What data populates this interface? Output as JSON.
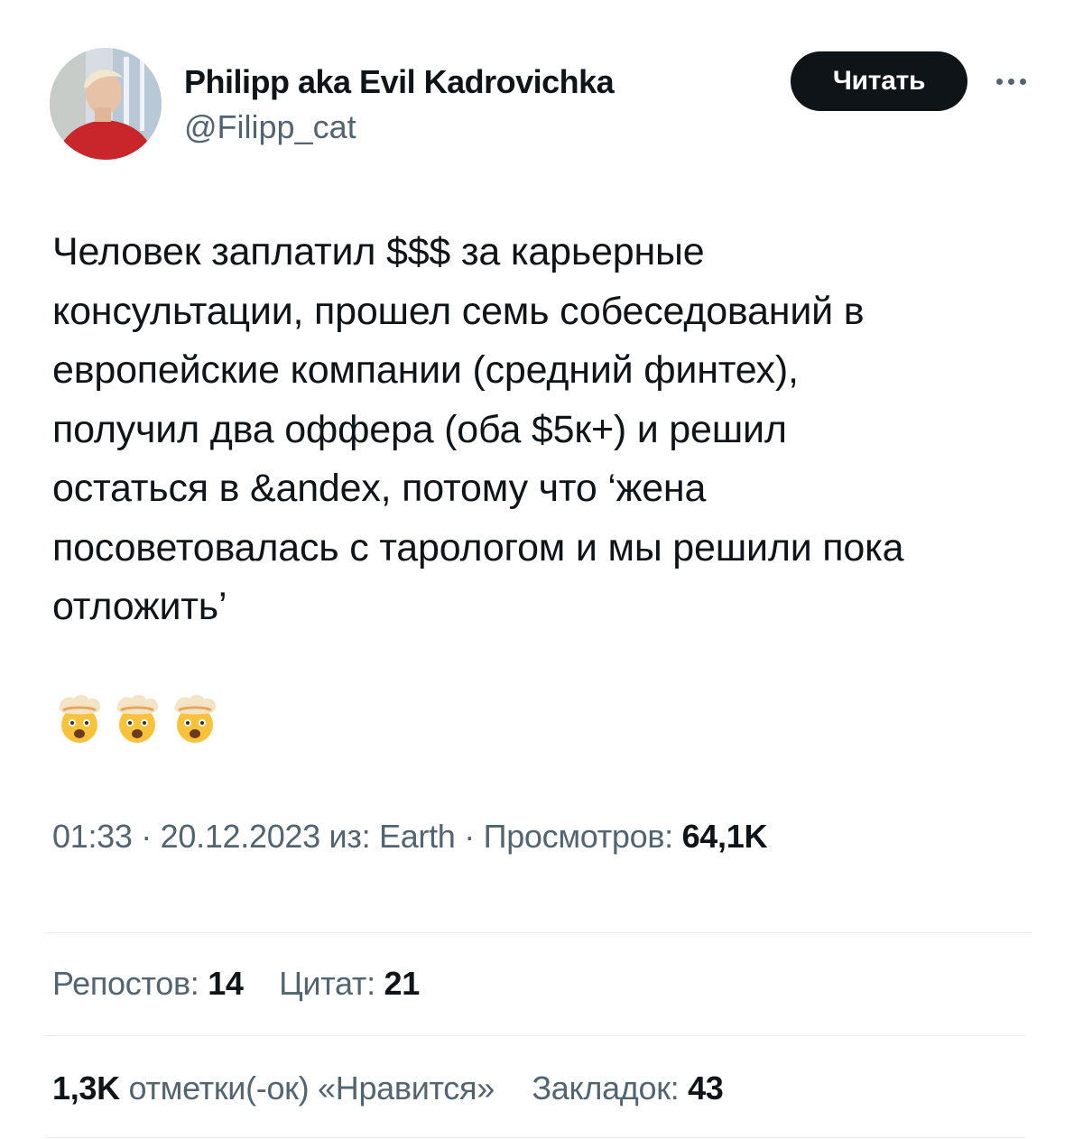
{
  "author": {
    "display_name": "Philipp aka Evil Kadrovichka",
    "handle": "@Filipp_cat",
    "avatar_icon": "profile-photo"
  },
  "follow_button": {
    "label": "Читать"
  },
  "more_button": {
    "icon": "more-horizontal-icon"
  },
  "tweet": {
    "lines": [
      "Человек заплатил $$$ за карьерные",
      "консультации, прошел семь собеседований в",
      "европейские компании (средний финтех),",
      "получил два оффера (оба $5к+) и решил",
      "остаться в &andex, потому что ‘жена",
      "посоветовалась с тарологом и мы решили пока",
      "отложить’"
    ],
    "emoji": [
      "exploding-head-emoji",
      "exploding-head-emoji",
      "exploding-head-emoji"
    ]
  },
  "meta": {
    "prefix": "01:33 · 20.12.2023 из: Earth · Просмотров: ",
    "views": "64,1K"
  },
  "stats": {
    "reposts_label": "Репостов: ",
    "reposts": "14",
    "quotes_label": "Цитат: ",
    "quotes": "21",
    "likes": "1,3K",
    "likes_label": " отметки(-ок) «Нравится»",
    "bookmarks_label": "Закладок: ",
    "bookmarks": "43"
  },
  "colors": {
    "text": "#0f1419",
    "secondary": "#536471",
    "divider": "#e6e9eb",
    "button_bg": "#0f1419"
  }
}
